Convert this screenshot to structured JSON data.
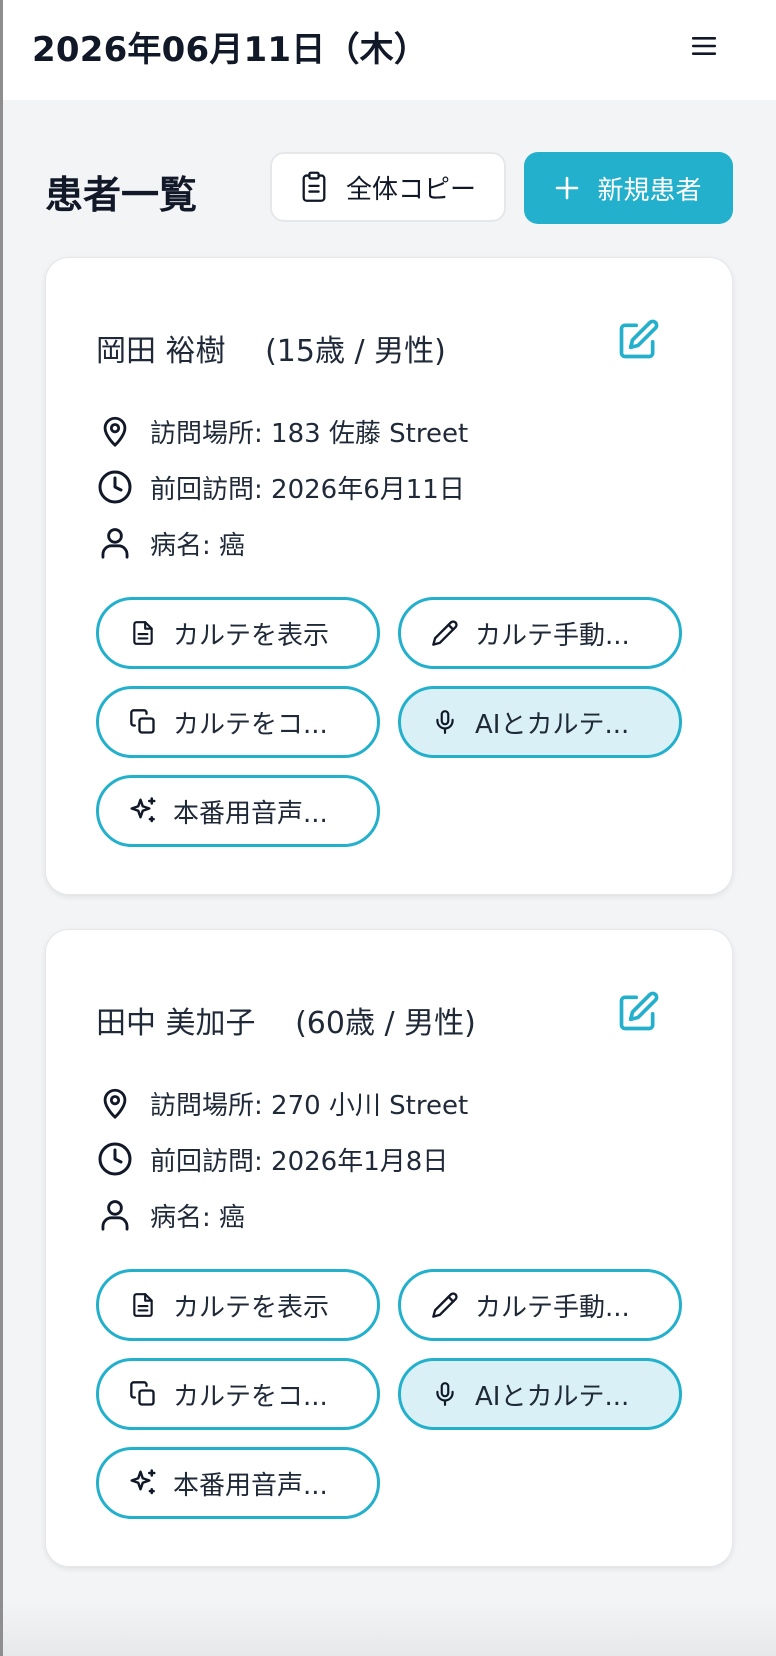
{
  "header": {
    "date": "2026年06月11日（木）",
    "menu_icon": "hamburger-menu-icon"
  },
  "list": {
    "title": "患者一覧",
    "copy_all_label": "全体コピー",
    "new_patient_label": "新規患者"
  },
  "colors": {
    "accent": "#22b0cc",
    "ai_button_bg": "#d9f1f6"
  },
  "patients": [
    {
      "name": "岡田 裕樹　 (15歳 / 男性)",
      "location": "訪問場所: 183 佐藤 Street",
      "last_visit": "前回訪問: 2026年6月11日",
      "disease": "病名: 癌",
      "actions": {
        "view": "カルテを表示",
        "manual": "カルテ手動...",
        "copy": "カルテをコ...",
        "ai": "AIとカルテ...",
        "voice": "本番用音声..."
      }
    },
    {
      "name": "田中 美加子　 (60歳 / 男性)",
      "location": "訪問場所: 270 小川 Street",
      "last_visit": "前回訪問: 2026年1月8日",
      "disease": "病名: 癌",
      "actions": {
        "view": "カルテを表示",
        "manual": "カルテ手動...",
        "copy": "カルテをコ...",
        "ai": "AIとカルテ...",
        "voice": "本番用音声..."
      }
    }
  ]
}
